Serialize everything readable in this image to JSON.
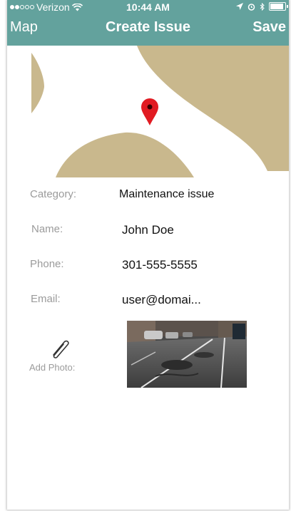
{
  "status_bar": {
    "carrier": "Verizon",
    "signal_bars": 2,
    "time": "10:44 AM"
  },
  "nav": {
    "back_label": "Map",
    "title": "Create Issue",
    "save_label": "Save"
  },
  "colors": {
    "header": "#63a29d",
    "map_land": "#c9b88d",
    "pin": "#e11b22",
    "label": "#9b9b9b"
  },
  "form": {
    "category": {
      "label": "Category:",
      "value": "Maintenance issue"
    },
    "name": {
      "label": "Name:",
      "value": "John Doe"
    },
    "phone": {
      "label": "Phone:",
      "value": "301-555-5555"
    },
    "email": {
      "label": "Email:",
      "value": "user@domai..."
    }
  },
  "photo": {
    "add_label": "Add Photo:",
    "icon": "paperclip-icon"
  }
}
